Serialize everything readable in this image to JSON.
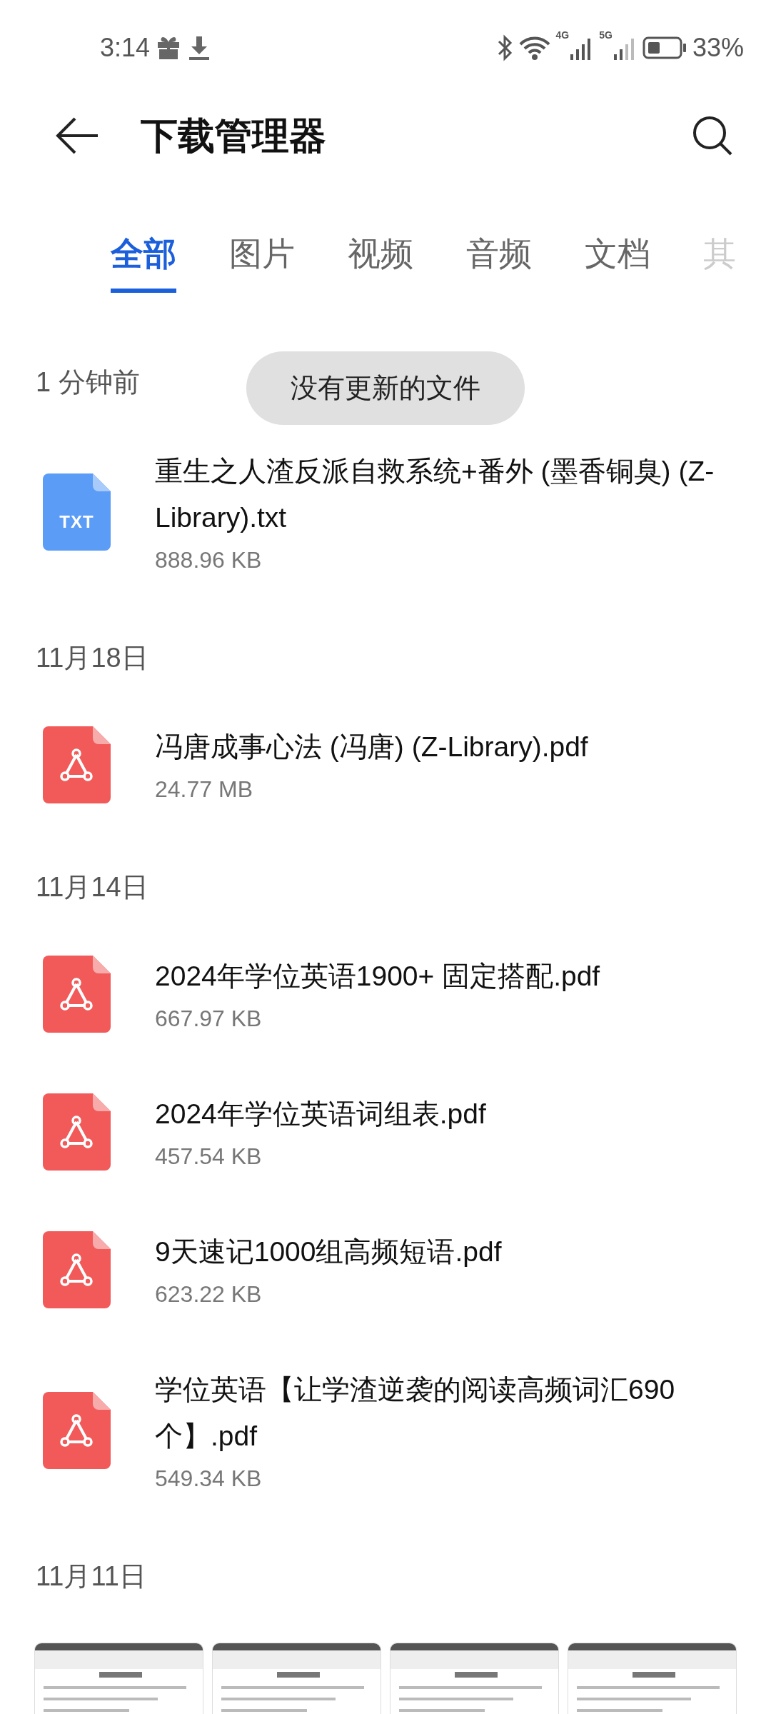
{
  "status_bar": {
    "time": "3:14",
    "net_4g": "4G",
    "net_5g": "5G",
    "battery": "33%"
  },
  "header": {
    "title": "下载管理器"
  },
  "tabs": [
    {
      "label": "全部",
      "selected": true
    },
    {
      "label": "图片",
      "selected": false
    },
    {
      "label": "视频",
      "selected": false
    },
    {
      "label": "音频",
      "selected": false
    },
    {
      "label": "文档",
      "selected": false
    },
    {
      "label": "其",
      "selected": false
    }
  ],
  "toast": "没有更新的文件",
  "sections": [
    {
      "date": "1 分钟前",
      "files": [
        {
          "kind": "txt",
          "icon_label": "TXT",
          "name": "重生之人渣反派自救系统+番外 (墨香铜臭) (Z-Library).txt",
          "size": "888.96 KB"
        }
      ]
    },
    {
      "date": "11月18日",
      "files": [
        {
          "kind": "pdf",
          "name": "冯唐成事心法 (冯唐) (Z-Library).pdf",
          "size": "24.77 MB"
        }
      ]
    },
    {
      "date": "11月14日",
      "files": [
        {
          "kind": "pdf",
          "name": "2024年学位英语1900+ 固定搭配.pdf",
          "size": "667.97 KB"
        },
        {
          "kind": "pdf",
          "name": "2024年学位英语词组表.pdf",
          "size": "457.54 KB"
        },
        {
          "kind": "pdf",
          "name": "9天速记1000组高频短语.pdf",
          "size": "623.22 KB"
        },
        {
          "kind": "pdf",
          "name": "学位英语【让学渣逆袭的阅读高频词汇690个】.pdf",
          "size": "549.34 KB"
        }
      ]
    },
    {
      "date": "11月11日"
    }
  ]
}
